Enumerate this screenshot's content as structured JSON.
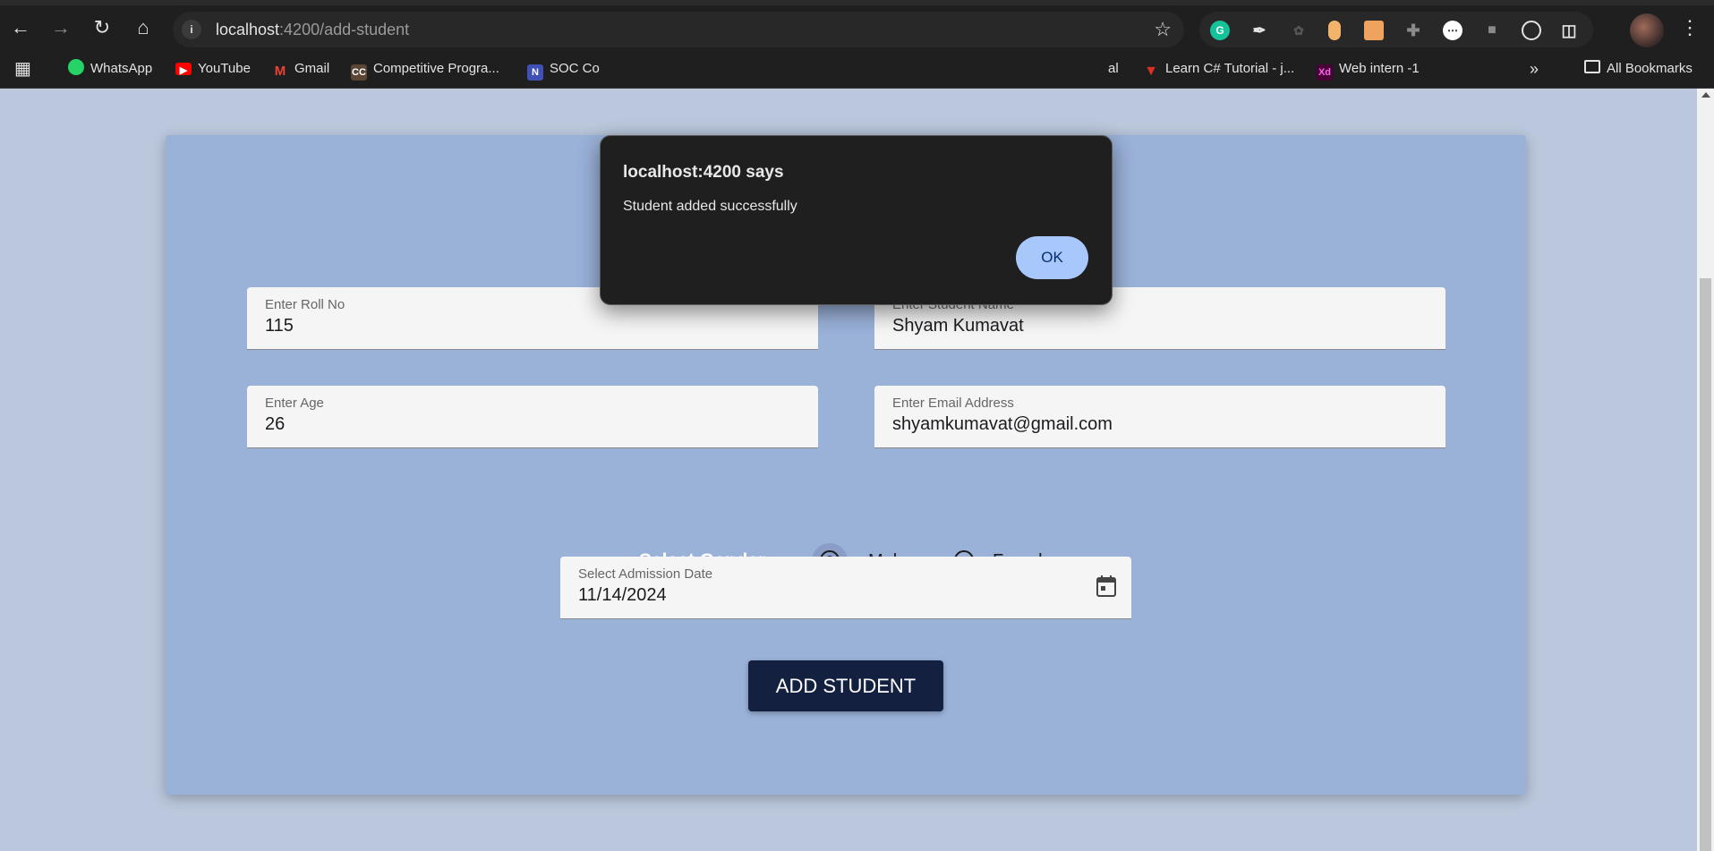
{
  "browser": {
    "url_host": "localhost",
    "url_rest": ":4200/add-student",
    "bookmarks": [
      {
        "label": "WhatsApp",
        "icon": "whatsapp-icon",
        "color": "#25d366"
      },
      {
        "label": "YouTube",
        "icon": "youtube-icon",
        "color": "#ff0000"
      },
      {
        "label": "Gmail",
        "icon": "gmail-icon",
        "color": "#ea4335"
      },
      {
        "label": "Competitive Progra...",
        "icon": "cc-icon",
        "color": "#5b4636",
        "glyph": "CC"
      },
      {
        "label": "SOC Co",
        "icon": "n-icon",
        "color": "#3f51b5",
        "glyph": "N"
      },
      {
        "label": "al",
        "icon": "",
        "color": ""
      },
      {
        "label": "Learn C# Tutorial - j...",
        "icon": "tutorial-icon",
        "color": "#d93025"
      },
      {
        "label": "Web intern -1",
        "icon": "xd-icon",
        "color": "#470137",
        "glyph": "Xd"
      }
    ],
    "all_bookmarks": "All Bookmarks"
  },
  "form": {
    "roll_label": "Enter Roll No",
    "roll_value": "115",
    "name_label": "Enter Student Name",
    "name_value": "Shyam Kumavat",
    "age_label": "Enter Age",
    "age_value": "26",
    "email_label": "Enter Email Address",
    "email_value": "shyamkumavat@gmail.com",
    "gender_title": "Select Gender",
    "gender_options": [
      "Male",
      "Female"
    ],
    "gender_selected": "Male",
    "date_label": "Select Admission Date",
    "date_value": "11/14/2024",
    "submit_label": "ADD STUDENT"
  },
  "dialog": {
    "title": "localhost:4200 says",
    "message": "Student added successfully",
    "ok_label": "OK"
  },
  "colors": {
    "card": "#9ab1d8",
    "button": "#132040",
    "page_bg": "#bac7dc"
  }
}
